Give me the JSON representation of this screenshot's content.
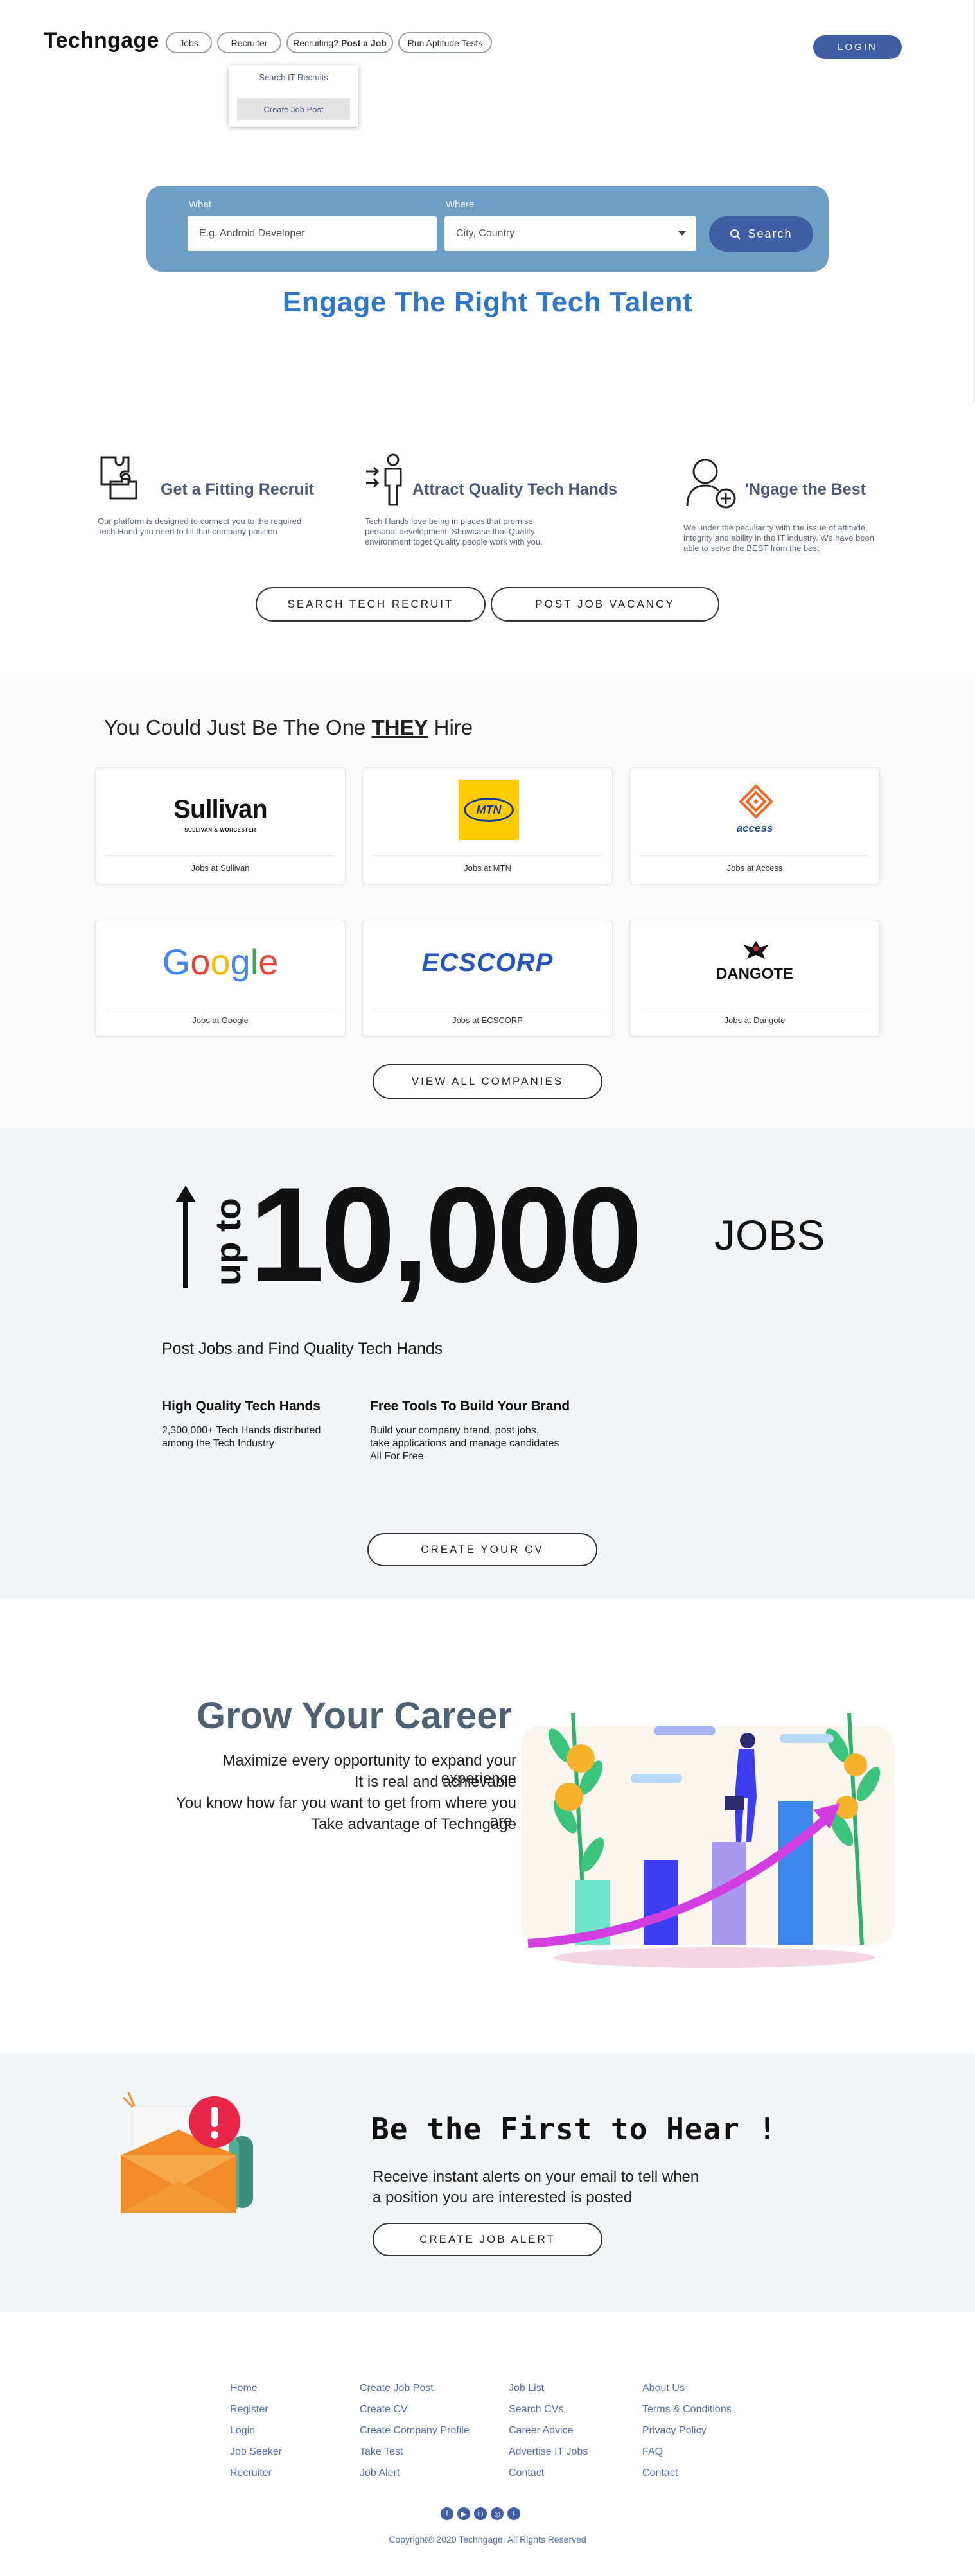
{
  "header": {
    "logo": "Techngage",
    "nav": {
      "jobs": "Jobs",
      "recruiter": "Recruiter",
      "recruiting_prefix": "Recruiting?",
      "recruiting_bold": "Post a Job",
      "aptitude": "Run Aptitude Tests"
    },
    "login": "LOGIN",
    "dropdown": [
      "Search IT Recruits",
      "Create Job Post"
    ]
  },
  "search": {
    "what_label": "What",
    "what_placeholder": "E.g. Android Developer",
    "where_label": "Where",
    "where_value": "City, Country",
    "button": "Search"
  },
  "hero": {
    "title": "Engage The Right Tech Talent"
  },
  "features": [
    {
      "title": "Get a Fitting Recruit",
      "icon": "puzzle-icon",
      "text": [
        "Our platform is designed to connect you to the required",
        "Tech Hand you need to fill that company position"
      ]
    },
    {
      "title": "Attract Quality Tech Hands",
      "icon": "magnet-person-icon",
      "text": [
        "Tech Hands love being in places that promise",
        "personal development. Showcase that Quality",
        "environment toget Quality people work with you."
      ]
    },
    {
      "title": "'Ngage the Best",
      "icon": "user-add-icon",
      "text": [
        "We under the peculiarity with the issue of attitude,",
        "integrity and ability in the IT industry. We have been",
        "able to seive the BEST from the best"
      ]
    }
  ],
  "feature_buttons": {
    "search": "SEARCH TECH RECRUIT",
    "post": "POST JOB VACANCY"
  },
  "companies": {
    "title_prefix": "You Could Just Be The One ",
    "title_bold": "THEY",
    "title_suffix": " Hire",
    "items": [
      {
        "name": "Sullivan",
        "sub": "SULLIVAN & WORCESTER",
        "label": "Jobs at Sullivan"
      },
      {
        "name": "MTN",
        "label": "Jobs at MTN"
      },
      {
        "name": "access",
        "label": "Jobs at Access"
      },
      {
        "name": "Google",
        "label": "Jobs at Google"
      },
      {
        "name": "ECSCORP",
        "label": "Jobs at ECSCORP"
      },
      {
        "name": "DANGOTE",
        "label": "Jobs at Dangote"
      }
    ],
    "view_all": "VIEW ALL COMPANIES"
  },
  "jobs_block": {
    "upto": "up to",
    "number": "10,000",
    "jobs": "JOBS",
    "subtitle": "Post Jobs and Find Quality Tech Hands",
    "col1_title": "High Quality Tech Hands",
    "col1_text": [
      "2,300,000+ Tech Hands distributed",
      "among the Tech Industry"
    ],
    "col2_title": "Free Tools To Build Your Brand",
    "col2_text": [
      "Build your company brand, post jobs,",
      "take applications and manage candidates",
      "All For Free"
    ],
    "cta": "CREATE YOUR CV"
  },
  "career": {
    "title": "Grow Your Career",
    "lines": [
      "Maximize every opportunity to expand your experience",
      "It is real and achievable",
      "You know how far you want to get from where you are.",
      "Take advantage of Techngage"
    ]
  },
  "alert": {
    "title": "Be the First to Hear !",
    "text": [
      "Receive instant alerts on your email to tell when",
      "a position you are interested is posted"
    ],
    "cta": "CREATE JOB ALERT"
  },
  "footer": {
    "col1": [
      "Home",
      "Register",
      "Login",
      "Job Seeker",
      "Recruiter"
    ],
    "col2": [
      "Create Job Post",
      "Create CV",
      "Create Company Profile",
      "Take Test",
      "Job Alert"
    ],
    "col3": [
      "Job List",
      "Search CVs",
      "Career Advice",
      "Advertise IT Jobs",
      "Contact"
    ],
    "col4": [
      "About Us",
      "Terms & Conditions",
      "Privacy Policy",
      "FAQ",
      "Contact"
    ],
    "social": [
      "facebook-icon",
      "youtube-icon",
      "linkedin-icon",
      "instagram-icon",
      "twitter-icon"
    ],
    "copyright": "Copyright© 2020 Techngage. All Rights Reserved"
  },
  "colors": {
    "primary": "#3f5fa2",
    "search_panel": "#6f9ec4",
    "hero_title": "#2f77c6",
    "feature_title": "#4a5a78",
    "link": "#4e6fb6",
    "section_bg": "#f3f6f7"
  }
}
